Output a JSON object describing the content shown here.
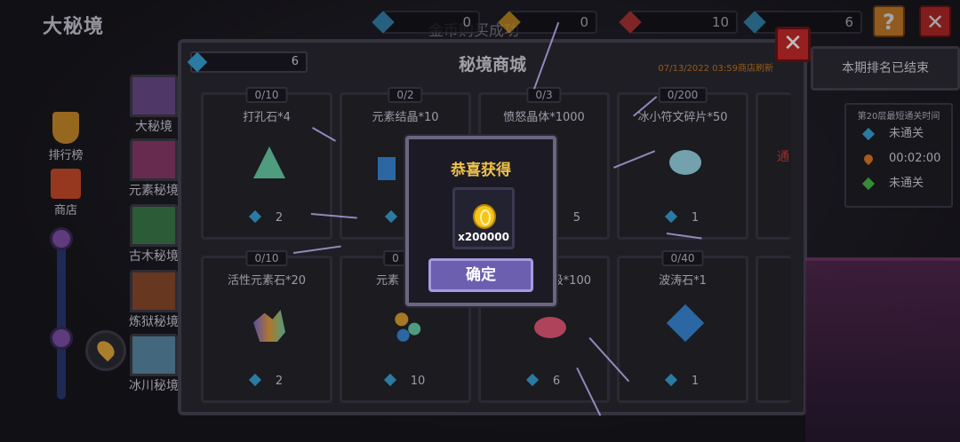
{
  "page_title": "大秘境",
  "currency_bars": [
    {
      "value": "0",
      "color": "#3aa3d8"
    },
    {
      "value": "0",
      "color": "#e6a323"
    },
    {
      "value": "10",
      "color": "#d63b3b"
    },
    {
      "value": "6",
      "color": "#3aa3d8"
    }
  ],
  "toast_text": "金币购买成功",
  "sidebar": {
    "leaderboard_label": "排行榜",
    "shop_label": "商店"
  },
  "areas": [
    {
      "label": "大秘境",
      "color": "#6a4a8a"
    },
    {
      "label": "元素秘境",
      "color": "#8a3a6a"
    },
    {
      "label": "古木秘境",
      "color": "#3a7a4a"
    },
    {
      "label": "炼狱秘境",
      "color": "#8a4a2a"
    },
    {
      "label": "冰川秘境",
      "color": "#5a8aa6"
    }
  ],
  "shop": {
    "title": "秘境商城",
    "gem_count": "6",
    "refresh_text": "07/13/2022 03:59商店刷新",
    "items": [
      {
        "stock": "0/10",
        "name": "打孔石*4",
        "price": "2",
        "icon_color": "#6ad1a8"
      },
      {
        "stock": "0/2",
        "name": "元素结晶*10",
        "price": "",
        "icon_color": "#3a8ad8"
      },
      {
        "stock": "0/3",
        "name": "愤怒晶体*1000",
        "price": "5",
        "icon_color": "#c85050"
      },
      {
        "stock": "0/200",
        "name": "冰小符文碎片*50",
        "price": "1",
        "icon_color": "#9ad8e8"
      },
      {
        "stock": "0/10",
        "name": "活性元素石*20",
        "price": "2",
        "icon_color": "#7a6ad8"
      },
      {
        "stock": "0",
        "name": "元素",
        "price": "10",
        "icon_color": "#e0a030"
      },
      {
        "stock": "",
        "name": "极*100",
        "price": "6",
        "icon_color": "#e85a7a"
      },
      {
        "stock": "0/40",
        "name": "波涛石*1",
        "price": "1",
        "icon_color": "#3a8ad8"
      }
    ]
  },
  "right_panel": {
    "rank_status": "本期排名已结束",
    "fastest_header": "第20层最短通关时间",
    "rows": [
      {
        "value": "未通关",
        "color": "#3aa3d8"
      },
      {
        "value": "00:02:00",
        "color": "#e07a2a"
      },
      {
        "value": "未通关",
        "color": "#4ab84a"
      }
    ],
    "side_char": "通"
  },
  "modal": {
    "title": "恭喜获得",
    "reward_qty": "x200000",
    "confirm_label": "确定"
  },
  "icons": {
    "help": "?",
    "close": "✕"
  }
}
